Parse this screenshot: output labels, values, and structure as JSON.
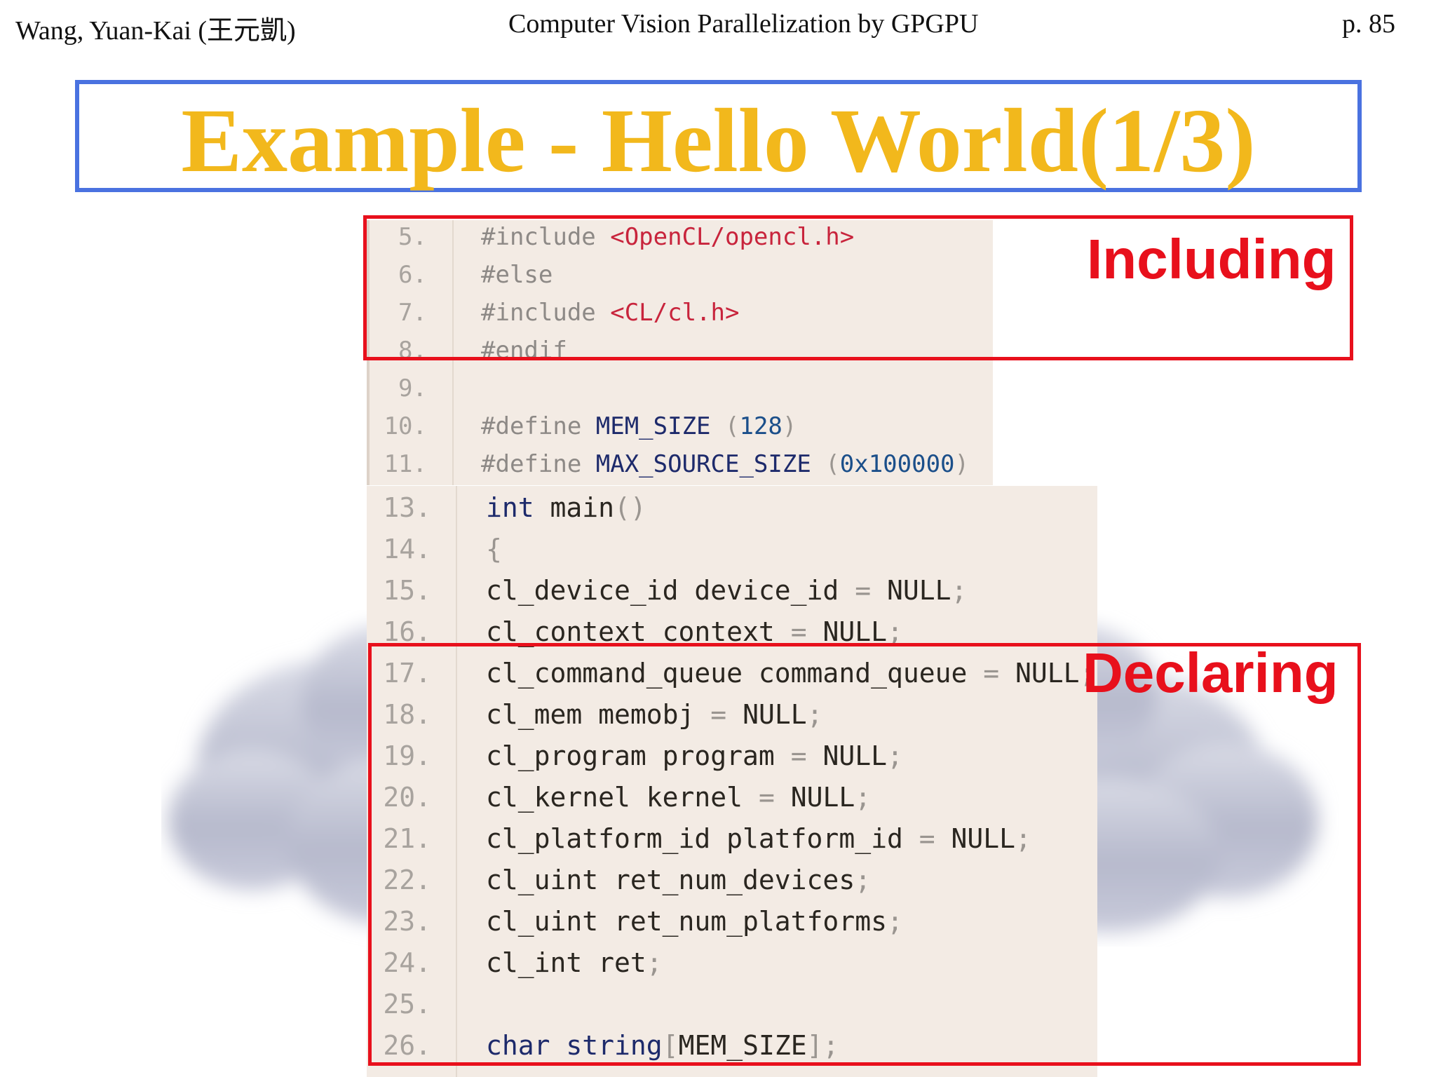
{
  "header": {
    "author": "Wang, Yuan-Kai (王元凱)",
    "course_title": "Computer Vision Parallelization by GPGPU",
    "page": "p. 85"
  },
  "slide": {
    "title": "Example - Hello World(1/3)"
  },
  "annotations": {
    "including_label": "Including",
    "declaring_label": "Declaring"
  },
  "colors": {
    "title": "#f2b81c",
    "title_border": "#4a72e0",
    "annotation": "#e8101c",
    "code_bg": "#f3ebe4"
  },
  "code_top": [
    {
      "ln": "5.",
      "parts": [
        {
          "t": "#include ",
          "c": ""
        },
        {
          "t": "<OpenCL/opencl.h>",
          "c": "tok-inc"
        }
      ]
    },
    {
      "ln": "6.",
      "parts": [
        {
          "t": "#else",
          "c": ""
        }
      ]
    },
    {
      "ln": "7.",
      "parts": [
        {
          "t": "#include ",
          "c": ""
        },
        {
          "t": "<CL/cl.h>",
          "c": "tok-inc"
        }
      ]
    },
    {
      "ln": "8.",
      "parts": [
        {
          "t": "#endif",
          "c": ""
        }
      ]
    },
    {
      "ln": "9.",
      "parts": []
    },
    {
      "ln": "10.",
      "parts": [
        {
          "t": "#define ",
          "c": ""
        },
        {
          "t": "MEM_SIZE ",
          "c": "tok-kw"
        },
        {
          "t": "(",
          "c": "tok-punc"
        },
        {
          "t": "128",
          "c": "tok-num"
        },
        {
          "t": ")",
          "c": "tok-punc"
        }
      ]
    },
    {
      "ln": "11.",
      "parts": [
        {
          "t": "#define ",
          "c": ""
        },
        {
          "t": "MAX_SOURCE_SIZE ",
          "c": "tok-kw"
        },
        {
          "t": "(",
          "c": "tok-punc"
        },
        {
          "t": "0x100000",
          "c": "tok-num"
        },
        {
          "t": ")",
          "c": "tok-punc"
        }
      ]
    }
  ],
  "code_main": [
    {
      "ln": "13.",
      "parts": [
        {
          "t": "int ",
          "c": "tok-kw"
        },
        {
          "t": "main",
          "c": ""
        },
        {
          "t": "()",
          "c": "tok-punc"
        }
      ]
    },
    {
      "ln": "14.",
      "parts": [
        {
          "t": "{",
          "c": "tok-punc"
        }
      ]
    },
    {
      "ln": "15.",
      "parts": [
        {
          "t": "cl_device_id device_id ",
          "c": ""
        },
        {
          "t": "= ",
          "c": "tok-punc"
        },
        {
          "t": "NULL",
          "c": ""
        },
        {
          "t": ";",
          "c": "tok-punc"
        }
      ]
    },
    {
      "ln": "16.",
      "parts": [
        {
          "t": "cl_context context ",
          "c": ""
        },
        {
          "t": "= ",
          "c": "tok-punc"
        },
        {
          "t": "NULL",
          "c": ""
        },
        {
          "t": ";",
          "c": "tok-punc"
        }
      ]
    },
    {
      "ln": "17.",
      "parts": [
        {
          "t": "cl_command_queue command_queue ",
          "c": ""
        },
        {
          "t": "= ",
          "c": "tok-punc"
        },
        {
          "t": "NULL",
          "c": ""
        },
        {
          "t": ";",
          "c": "tok-punc"
        }
      ]
    },
    {
      "ln": "18.",
      "parts": [
        {
          "t": "cl_mem memobj ",
          "c": ""
        },
        {
          "t": "= ",
          "c": "tok-punc"
        },
        {
          "t": "NULL",
          "c": ""
        },
        {
          "t": ";",
          "c": "tok-punc"
        }
      ]
    },
    {
      "ln": "19.",
      "parts": [
        {
          "t": "cl_program program ",
          "c": ""
        },
        {
          "t": "= ",
          "c": "tok-punc"
        },
        {
          "t": "NULL",
          "c": ""
        },
        {
          "t": ";",
          "c": "tok-punc"
        }
      ]
    },
    {
      "ln": "20.",
      "parts": [
        {
          "t": "cl_kernel kernel ",
          "c": ""
        },
        {
          "t": "= ",
          "c": "tok-punc"
        },
        {
          "t": "NULL",
          "c": ""
        },
        {
          "t": ";",
          "c": "tok-punc"
        }
      ]
    },
    {
      "ln": "21.",
      "parts": [
        {
          "t": "cl_platform_id platform_id ",
          "c": ""
        },
        {
          "t": "= ",
          "c": "tok-punc"
        },
        {
          "t": "NULL",
          "c": ""
        },
        {
          "t": ";",
          "c": "tok-punc"
        }
      ]
    },
    {
      "ln": "22.",
      "parts": [
        {
          "t": "cl_uint ret_num_devices",
          "c": ""
        },
        {
          "t": ";",
          "c": "tok-punc"
        }
      ]
    },
    {
      "ln": "23.",
      "parts": [
        {
          "t": "cl_uint ret_num_platforms",
          "c": ""
        },
        {
          "t": ";",
          "c": "tok-punc"
        }
      ]
    },
    {
      "ln": "24.",
      "parts": [
        {
          "t": "cl_int ret",
          "c": ""
        },
        {
          "t": ";",
          "c": "tok-punc"
        }
      ]
    },
    {
      "ln": "25.",
      "parts": []
    },
    {
      "ln": "26.",
      "parts": [
        {
          "t": "char ",
          "c": "tok-kw"
        },
        {
          "t": "string",
          "c": "tok-kw"
        },
        {
          "t": "[",
          "c": "tok-punc"
        },
        {
          "t": "MEM_SIZE",
          "c": ""
        },
        {
          "t": "]",
          "c": "tok-punc"
        },
        {
          "t": ";",
          "c": "tok-punc"
        }
      ]
    }
  ]
}
